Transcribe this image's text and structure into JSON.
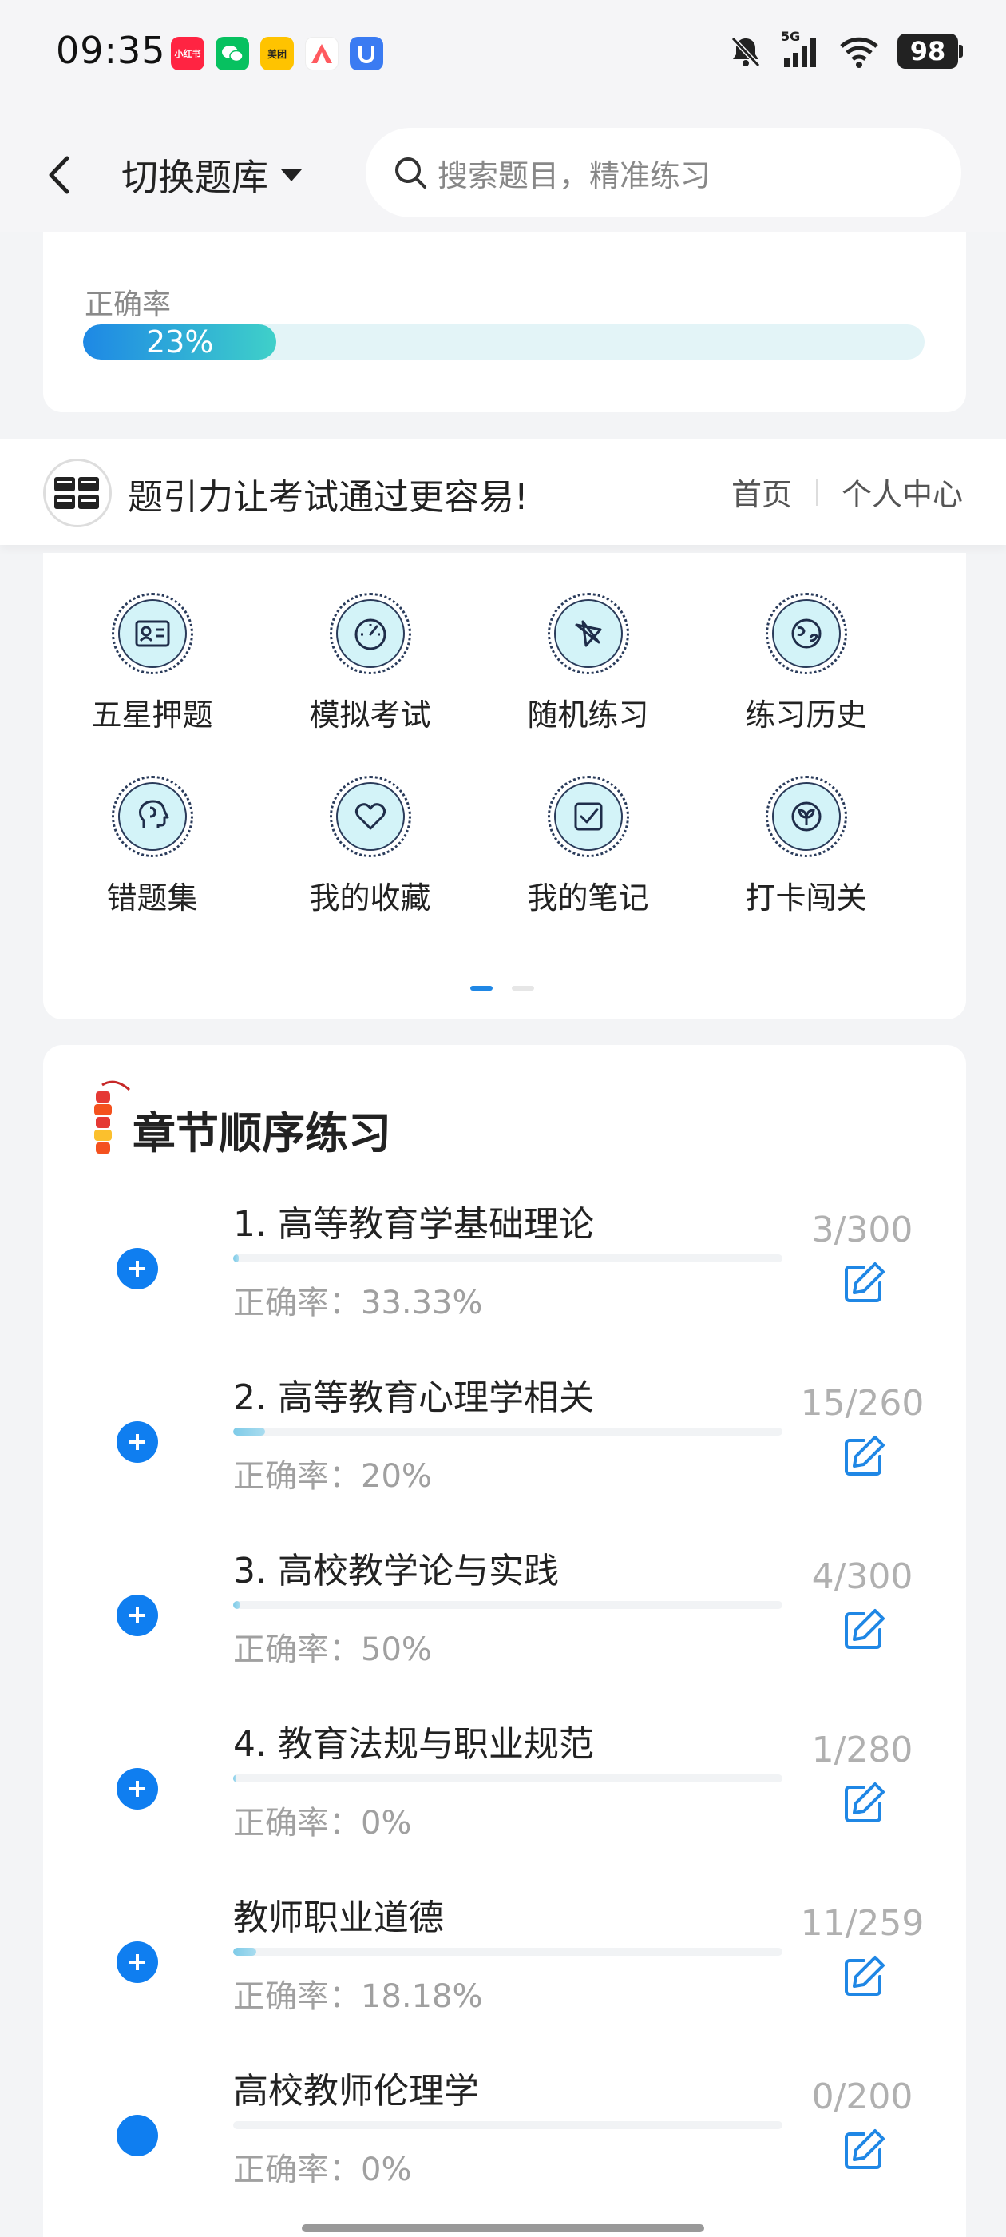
{
  "status_bar": {
    "time": "09:35",
    "apps": [
      {
        "name": "xiaohongshu-icon",
        "label": "小红书",
        "color": "#ff2442"
      },
      {
        "name": "wechat-icon",
        "label": "",
        "color": "#07c160"
      },
      {
        "name": "meituan-icon",
        "label": "美团",
        "color": "#ffc300"
      },
      {
        "name": "app-icon",
        "label": "",
        "color": "#ff5a5f"
      },
      {
        "name": "shield-app-icon",
        "label": "",
        "color": "#3a7bf2"
      }
    ],
    "network": "5G",
    "battery": "98"
  },
  "header": {
    "switch_label": "切换题库",
    "search_placeholder": "搜索题目，精准练习"
  },
  "accuracy_card": {
    "label": "正确率",
    "value_text": "23%",
    "value": 0.23
  },
  "banner": {
    "slogan": "题引力让考试通过更容易!",
    "links": [
      "首页",
      "个人中心"
    ]
  },
  "features": [
    {
      "label": "五星押题",
      "icon": "id-card-icon"
    },
    {
      "label": "模拟考试",
      "icon": "gauge-icon"
    },
    {
      "label": "随机练习",
      "icon": "shuffle-icon"
    },
    {
      "label": "练习历史",
      "icon": "globe-icon"
    },
    {
      "label": "错题集",
      "icon": "head-icon"
    },
    {
      "label": "我的收藏",
      "icon": "heart-icon"
    },
    {
      "label": "我的笔记",
      "icon": "checkbox-icon"
    },
    {
      "label": "打卡闯关",
      "icon": "sprout-icon"
    }
  ],
  "chapters_section": {
    "title": "章节顺序练习",
    "items": [
      {
        "name": "1. 高等教育学基础理论",
        "count": "3/300",
        "accuracy": "正确率：33.33%",
        "progress": 0.01
      },
      {
        "name": "2. 高等教育心理学相关",
        "count": "15/260",
        "accuracy": "正确率：20%",
        "progress": 0.058
      },
      {
        "name": "3. 高校教学论与实践",
        "count": "4/300",
        "accuracy": "正确率：50%",
        "progress": 0.013
      },
      {
        "name": "4. 教育法规与职业规范",
        "count": "1/280",
        "accuracy": "正确率：0%",
        "progress": 0.004
      },
      {
        "name": "教师职业道德",
        "count": "11/259",
        "accuracy": "正确率：18.18%",
        "progress": 0.042
      },
      {
        "name": "高校教师伦理学",
        "count": "0/200",
        "accuracy": "正确率：0%",
        "progress": 0
      }
    ]
  }
}
